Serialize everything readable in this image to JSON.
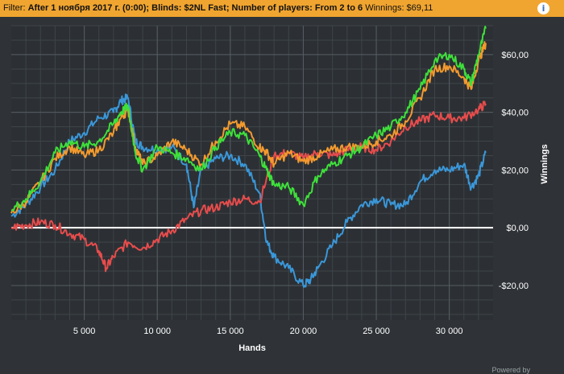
{
  "filter": {
    "prefix": "Filter:",
    "summary": "After 1 ноября 2017 г. (0:00); Blinds: $2NL Fast; Number of players: From 2 to 6",
    "winnings": "Winnings: $69,11"
  },
  "info_icon": "info-icon",
  "footer": {
    "powered_by": "Powered by"
  },
  "colors": {
    "blue": "#3a97d9",
    "red": "#e84c4c",
    "orange": "#f39a2e",
    "green": "#3ee03a",
    "zero_line": "#ffffff"
  },
  "chart_data": {
    "type": "line",
    "xlabel": "Hands",
    "ylabel": "Winnings",
    "xlim": [
      0,
      33000
    ],
    "ylim": [
      -32,
      70
    ],
    "x_ticks": [
      5000,
      10000,
      15000,
      20000,
      25000,
      30000
    ],
    "x_tick_labels": [
      "5 000",
      "10 000",
      "15 000",
      "20 000",
      "25 000",
      "30 000"
    ],
    "y_ticks": [
      -20,
      0,
      20,
      40,
      60
    ],
    "y_tick_labels": [
      "-$20,00",
      "$0,00",
      "$20,00",
      "$40,00",
      "$60,00"
    ],
    "grid": true,
    "series": [
      {
        "color_key": "blue",
        "x": [
          0,
          1000,
          2000,
          3000,
          4000,
          5000,
          6000,
          7000,
          7500,
          8000,
          8500,
          9000,
          10000,
          11000,
          12000,
          12500,
          13000,
          14000,
          15000,
          16000,
          17000,
          17500,
          18000,
          19000,
          20000,
          20500,
          21000,
          22000,
          23000,
          24000,
          25000,
          26000,
          27000,
          28000,
          29000,
          30000,
          31000,
          31500,
          32000,
          32500
        ],
        "values": [
          4,
          8,
          14,
          20,
          30,
          33,
          38,
          40,
          44,
          45,
          30,
          28,
          27,
          28,
          22,
          7,
          20,
          24,
          25,
          22,
          12,
          -5,
          -10,
          -14,
          -20,
          -18,
          -14,
          -6,
          2,
          8,
          10,
          8,
          8,
          16,
          20,
          20,
          22,
          14,
          18,
          26
        ]
      },
      {
        "color_key": "red",
        "x": [
          0,
          1000,
          2000,
          3000,
          4000,
          5000,
          6000,
          6500,
          7000,
          8000,
          9000,
          10000,
          11000,
          12000,
          13000,
          14000,
          15000,
          16000,
          17000,
          18000,
          19000,
          20000,
          21000,
          22000,
          23000,
          24000,
          25000,
          26000,
          27000,
          28000,
          29000,
          30000,
          31000,
          32000,
          32500
        ],
        "values": [
          0,
          1,
          2,
          1,
          -2,
          -4,
          -8,
          -14,
          -10,
          -5,
          -7,
          -4,
          -1,
          3,
          6,
          7,
          9,
          10,
          9,
          25,
          26,
          24,
          26,
          25,
          27,
          28,
          27,
          30,
          35,
          37,
          39,
          38,
          38,
          41,
          43
        ]
      },
      {
        "color_key": "orange",
        "x": [
          0,
          1000,
          2000,
          3000,
          4000,
          5000,
          6000,
          7000,
          7500,
          8000,
          8500,
          9000,
          10000,
          11000,
          12000,
          13000,
          14000,
          15000,
          16000,
          17000,
          17500,
          18000,
          19000,
          20000,
          21000,
          22000,
          23000,
          24000,
          25000,
          26000,
          27000,
          28000,
          29000,
          30000,
          31000,
          31500,
          32000,
          32500
        ],
        "values": [
          5,
          9,
          16,
          24,
          28,
          25,
          27,
          33,
          38,
          41,
          28,
          22,
          25,
          30,
          27,
          22,
          30,
          36,
          35,
          28,
          26,
          22,
          26,
          23,
          25,
          27,
          28,
          28,
          30,
          32,
          37,
          45,
          55,
          56,
          52,
          48,
          58,
          64
        ]
      },
      {
        "color_key": "green",
        "x": [
          0,
          1000,
          2000,
          3000,
          4000,
          5000,
          6000,
          7000,
          7500,
          8000,
          8500,
          9000,
          10000,
          11000,
          12000,
          13000,
          14000,
          15000,
          16000,
          17000,
          17500,
          18000,
          19000,
          20000,
          21000,
          22000,
          23000,
          24000,
          25000,
          26000,
          27000,
          28000,
          29000,
          30000,
          31000,
          31500,
          32000,
          32500
        ],
        "values": [
          6,
          10,
          16,
          26,
          30,
          28,
          30,
          36,
          40,
          42,
          26,
          20,
          28,
          26,
          24,
          20,
          28,
          33,
          32,
          25,
          20,
          15,
          14,
          8,
          18,
          22,
          25,
          28,
          32,
          35,
          40,
          48,
          58,
          60,
          55,
          50,
          60,
          69
        ]
      }
    ]
  }
}
